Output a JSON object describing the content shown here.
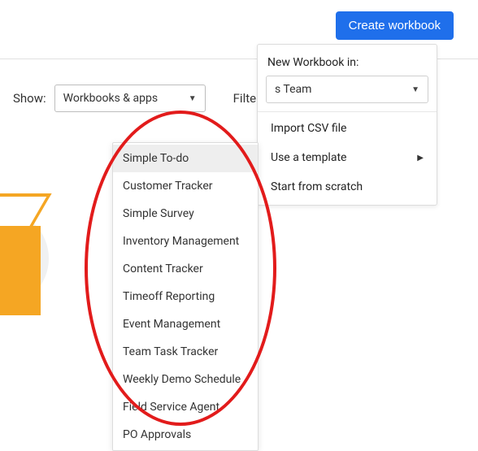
{
  "header": {
    "create_button": "Create workbook"
  },
  "filterbar": {
    "show_label": "Show:",
    "show_select_value": "Workbooks & apps",
    "filter_label": "Filte"
  },
  "create_panel": {
    "heading": "New Workbook in:",
    "team_select_value": "s Team",
    "items": {
      "import_csv": "Import CSV file",
      "use_template": "Use a template",
      "scratch": "Start from scratch"
    }
  },
  "templates": [
    "Simple To-do",
    "Customer Tracker",
    "Simple Survey",
    "Inventory Management",
    "Content Tracker",
    "Timeoff Reporting",
    "Event Management",
    "Team Task Tracker",
    "Weekly Demo Schedule",
    "Field Service Agent",
    "PO Approvals"
  ],
  "annotation": {
    "color": "#e21b1b"
  }
}
